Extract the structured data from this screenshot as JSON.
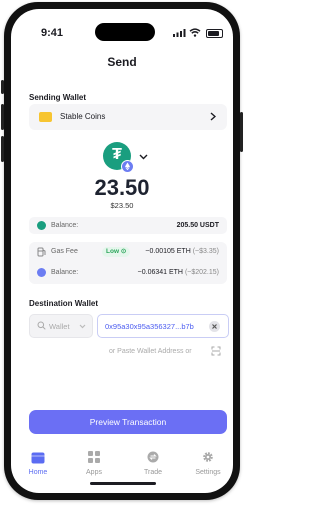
{
  "status": {
    "time": "9:41"
  },
  "header": {
    "title": "Send"
  },
  "sending_wallet": {
    "label": "Sending Wallet",
    "name": "Stable Coins",
    "icon": "wallet-icon",
    "accent": "#f7c531"
  },
  "token": {
    "icon": "tether-icon",
    "color": "#1a9e7f",
    "badge": "ethereum-icon"
  },
  "amount": {
    "value": "23.50",
    "fiat": "$23.50"
  },
  "balance": {
    "label": "Balance:",
    "value": "205.50 USDT"
  },
  "gas": {
    "fee_label": "Gas Fee",
    "speed": "Low",
    "fee_value": "~0.00105 ETH",
    "fee_fiat": "(~$3.35)",
    "balance_label": "Balance:",
    "balance_value": "~0.06341 ETH",
    "balance_fiat": "(~$202.15)"
  },
  "destination": {
    "label": "Destination Wallet",
    "wallet_placeholder": "Wallet",
    "address": "0x95a30x95a356327...b7b",
    "paste_hint": "or Paste Wallet Address or"
  },
  "actions": {
    "preview": "Preview Transaction"
  },
  "tabs": [
    {
      "label": "Home",
      "icon": "wallet-icon",
      "active": true
    },
    {
      "label": "Apps",
      "icon": "grid-icon",
      "active": false
    },
    {
      "label": "Trade",
      "icon": "trade-icon",
      "active": false
    },
    {
      "label": "Settings",
      "icon": "gear-icon",
      "active": false
    }
  ],
  "colors": {
    "primary": "#6b6ff4",
    "active_tab": "#5b6cf2",
    "success": "#2aa55a"
  }
}
